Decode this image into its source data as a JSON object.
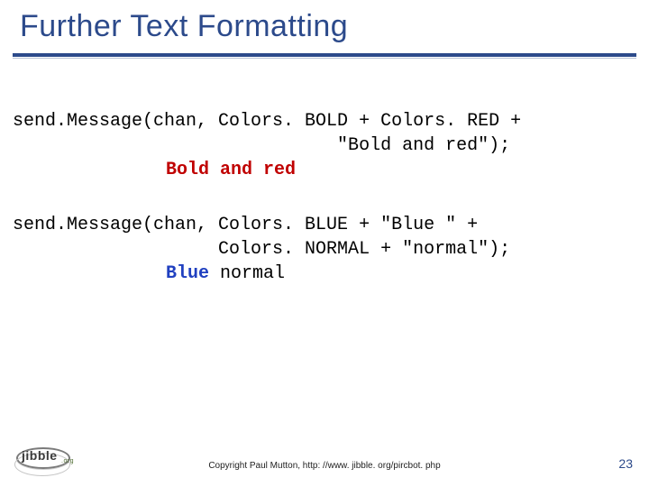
{
  "title": "Further Text Formatting",
  "code1_line1": "send.Message(chan, Colors. BOLD + Colors. RED +",
  "code1_line2": "                              \"Bold and red\");",
  "result1": "Bold and red",
  "code2_line1": "send.Message(chan, Colors. BLUE + \"Blue \" +",
  "code2_line2": "                   Colors. NORMAL + \"normal\");",
  "result2a": "Blue ",
  "result2b": "normal",
  "logo_text": "jibble",
  "logo_suffix": ".org",
  "copyright": "Copyright Paul Mutton, http: //www. jibble. org/pircbot. php",
  "page_number": "23"
}
